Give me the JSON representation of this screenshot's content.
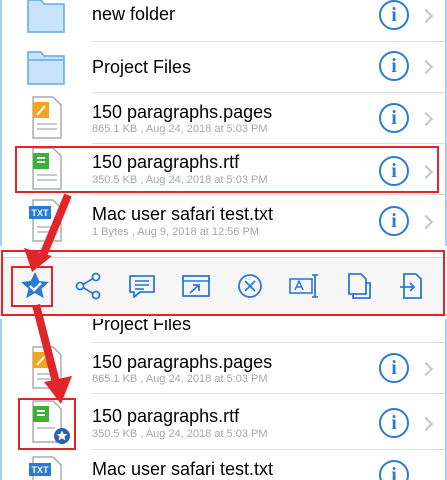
{
  "top_list": [
    {
      "name": "new folder",
      "meta": "",
      "icon": "folder-icon"
    },
    {
      "name": "Project Files",
      "meta": "",
      "icon": "folder-icon"
    },
    {
      "name": "150 paragraphs.pages",
      "meta": "865.1 KB , Aug 24, 2018 at 5:03 PM",
      "icon": "pages-file-icon"
    },
    {
      "name": "150 paragraphs.rtf",
      "meta": "350.5 KB , Aug 24, 2018 at 5:03 PM",
      "icon": "rtf-file-icon"
    },
    {
      "name": "Mac user safari test.txt",
      "meta": "1 Bytes , Aug 9, 2018 at 12:56 PM",
      "icon": "txt-file-icon"
    }
  ],
  "bottom_list": [
    {
      "name": "Project Files",
      "meta": "",
      "icon": "folder-icon"
    },
    {
      "name": "150 paragraphs.pages",
      "meta": "865.1 KB , Aug 24, 2018 at 5:03 PM",
      "icon": "pages-file-icon"
    },
    {
      "name": "150 paragraphs.rtf",
      "meta": "350.5 KB , Aug 24, 2018 at 5:03 PM",
      "icon": "rtf-file-icon"
    },
    {
      "name": "Mac user safari test.txt",
      "meta": "",
      "icon": "txt-file-icon"
    }
  ],
  "info_glyph": "i",
  "txt_badge": "TXT",
  "toolbar": [
    "favorite-icon",
    "share-icon",
    "comment-icon",
    "open-in-icon",
    "delete-icon",
    "rename-icon",
    "copy-icon",
    "move-icon"
  ],
  "colors": {
    "accent": "#2b7ad6",
    "highlight": "#e0262b",
    "meta_text": "#a7a7a7",
    "pages_orange": "#f5a31a",
    "rtf_green": "#3fae3a"
  }
}
